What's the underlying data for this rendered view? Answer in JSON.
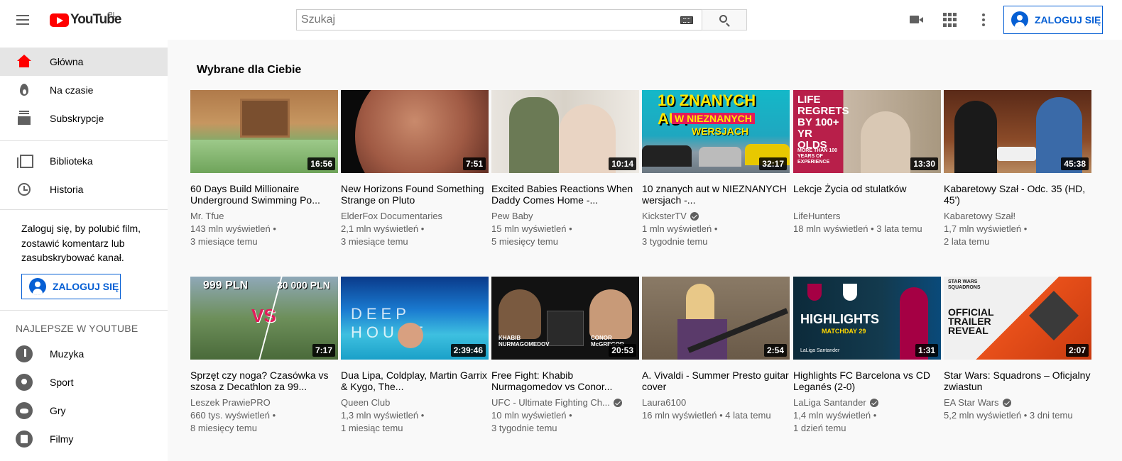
{
  "header": {
    "logo_text": "YouTube",
    "logo_region": "PL",
    "search_placeholder": "Szukaj",
    "signin_label": "ZALOGUJ SIĘ"
  },
  "sidebar": {
    "items": [
      {
        "label": "Główna",
        "icon": "home-icon"
      },
      {
        "label": "Na czasie",
        "icon": "trending-icon"
      },
      {
        "label": "Subskrypcje",
        "icon": "subscriptions-icon"
      },
      {
        "label": "Biblioteka",
        "icon": "library-icon"
      },
      {
        "label": "Historia",
        "icon": "history-icon"
      }
    ],
    "signin_prompt": "Zaloguj się, by polubić film, zostawić komentarz lub zasubskrybować kanał.",
    "signin_label": "ZALOGUJ SIĘ",
    "section_title": "NAJLEPSZE W YOUTUBE",
    "categories": [
      {
        "label": "Muzyka",
        "icon": "music-icon"
      },
      {
        "label": "Sport",
        "icon": "sport-icon"
      },
      {
        "label": "Gry",
        "icon": "gaming-icon"
      },
      {
        "label": "Filmy",
        "icon": "movies-icon"
      }
    ]
  },
  "main": {
    "section_title": "Wybrane dla Ciebie",
    "videos": [
      {
        "title": "60 Days Build Millionaire Underground Swimming Po...",
        "channel": "Mr. Tfue",
        "views": "143 mln wyświetleń •",
        "age": "3 miesiące temu",
        "duration": "16:56",
        "verified": false
      },
      {
        "title": "New Horizons Found Something Strange on Pluto",
        "channel": "ElderFox Documentaries",
        "views": "2,1 mln wyświetleń •",
        "age": "3 miesiące temu",
        "duration": "7:51",
        "verified": false
      },
      {
        "title": "Excited Babies Reactions When Daddy Comes Home -...",
        "channel": "Pew Baby",
        "views": "15 mln wyświetleń •",
        "age": "5 miesięcy temu",
        "duration": "10:14",
        "verified": false
      },
      {
        "title": "10 znanych aut w NIEZNANYCH wersjach -...",
        "channel": "KicksterTV",
        "views": "1 mln wyświetleń •",
        "age": "3 tygodnie temu",
        "duration": "32:17",
        "verified": true
      },
      {
        "title": "Lekcje Życia od stulatków",
        "channel": "LifeHunters",
        "views": "18 mln wyświetleń • 3 lata temu",
        "age": "",
        "duration": "13:30",
        "verified": false
      },
      {
        "title": "Kabaretowy Szał - Odc. 35 (HD, 45')",
        "channel": "Kabaretowy Szał!",
        "views": "1,7 mln wyświetleń •",
        "age": "2 lata temu",
        "duration": "45:38",
        "verified": false
      },
      {
        "title": "Sprzęt czy noga? Czasówka vs szosa z Decathlon za 99...",
        "channel": "Leszek PrawiePRO",
        "views": "660 tys. wyświetleń •",
        "age": "8 miesięcy temu",
        "duration": "7:17",
        "verified": false
      },
      {
        "title": "Dua Lipa, Coldplay, Martin Garrix & Kygo, The...",
        "channel": "Queen Club",
        "views": "1,3 mln wyświetleń •",
        "age": "1 miesiąc temu",
        "duration": "2:39:46",
        "verified": false
      },
      {
        "title": "Free Fight: Khabib Nurmagomedov vs Conor...",
        "channel": "UFC - Ultimate Fighting Ch...",
        "views": "10 mln wyświetleń •",
        "age": "3 tygodnie temu",
        "duration": "20:53",
        "verified": true
      },
      {
        "title": "A. Vivaldi - Summer Presto guitar cover",
        "channel": "Laura6100",
        "views": "16 mln wyświetleń • 4 lata temu",
        "age": "",
        "duration": "2:54",
        "verified": false
      },
      {
        "title": "Highlights FC Barcelona vs CD Leganés (2-0)",
        "channel": "LaLiga Santander",
        "views": "1,4 mln wyświetleń •",
        "age": "1 dzień temu",
        "duration": "1:31",
        "verified": true
      },
      {
        "title": "Star Wars: Squadrons – Oficjalny zwiastun",
        "channel": "EA Star Wars",
        "views": "5,2 mln wyświetleń • 3 dni temu",
        "age": "",
        "duration": "2:07",
        "verified": true
      }
    ],
    "thumb_text": {
      "v4_line1": "10 ZNANYCH AUT",
      "v4_line2": "W NIEZNANYCH",
      "v4_line3": "WERSJACH",
      "v5_big": "LIFE REGRETS BY 100+ YR OLDS",
      "v5_small": "MORE THAN 100 YEARS OF EXPERIENCE",
      "v7_left": "999 PLN",
      "v7_right": "30 000 PLN",
      "v7_vs": "VS",
      "v8": "DEEP HOUSE",
      "v9_left": "KHABIB NURMAGOMEDOV",
      "v9_right": "CONOR McGREGOR",
      "v11_big": "HIGHLIGHTS",
      "v11_small": "MATCHDAY 29",
      "v11_brand": "LaLiga Santander",
      "v12_brand": "STAR WARS SQUADRONS",
      "v12_big": "OFFICIAL TRAILER REVEAL"
    }
  },
  "colors": {
    "brand_red": "#ff0000",
    "link_blue": "#065fd4",
    "secondary_text": "#606060"
  }
}
